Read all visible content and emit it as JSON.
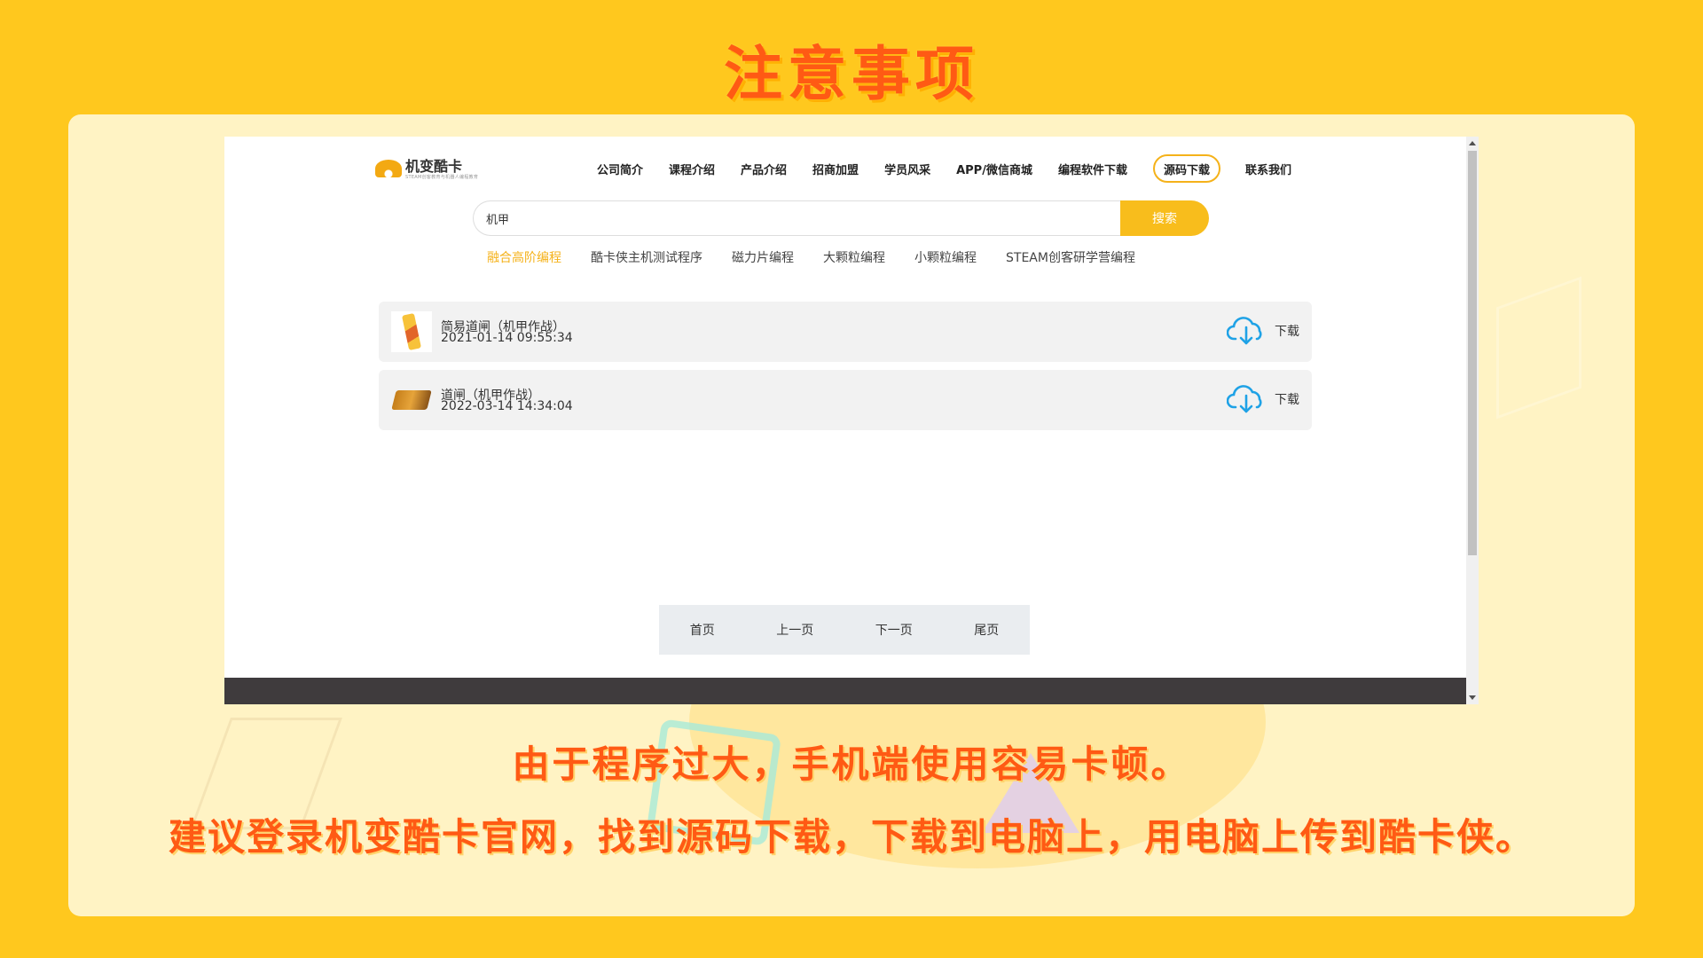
{
  "slide": {
    "heading": "注意事项",
    "notice_line1": "由于程序过大，手机端使用容易卡顿。",
    "notice_line2": "建议登录机变酷卡官网，找到源码下载，下载到电脑上，用电脑上传到酷卡侠。"
  },
  "site": {
    "logo_text": "机变酷卡",
    "logo_sub": "STEAM创客教育与机器人编程教育",
    "nav": [
      {
        "label": "公司简介"
      },
      {
        "label": "课程介绍"
      },
      {
        "label": "产品介绍"
      },
      {
        "label": "招商加盟"
      },
      {
        "label": "学员风采"
      },
      {
        "label": "APP/微信商城"
      },
      {
        "label": "编程软件下载"
      },
      {
        "label": "源码下载",
        "active": true
      },
      {
        "label": "联系我们"
      }
    ],
    "search": {
      "value": "机甲",
      "button": "搜索"
    },
    "categories": [
      {
        "label": "融合高阶编程",
        "active": true
      },
      {
        "label": "酷卡侠主机测试程序"
      },
      {
        "label": "磁力片编程"
      },
      {
        "label": "大颗粒编程"
      },
      {
        "label": "小颗粒编程"
      },
      {
        "label": "STEAM创客研学营编程"
      }
    ],
    "results": [
      {
        "title": "简易道闸（机甲作战）",
        "date": "2021-01-14 09:55:34",
        "action": "下载",
        "icon": "cloud-download-icon"
      },
      {
        "title": "道闸（机甲作战）",
        "date": "2022-03-14 14:34:04",
        "action": "下载",
        "icon": "cloud-download-icon"
      }
    ],
    "pager": {
      "first": "首页",
      "prev": "上一页",
      "next": "下一页",
      "last": "尾页"
    }
  },
  "colors": {
    "background": "#ffc81e",
    "heading": "#ff5a14",
    "accent": "#f8bd1c",
    "download_icon": "#1fa2e6"
  }
}
